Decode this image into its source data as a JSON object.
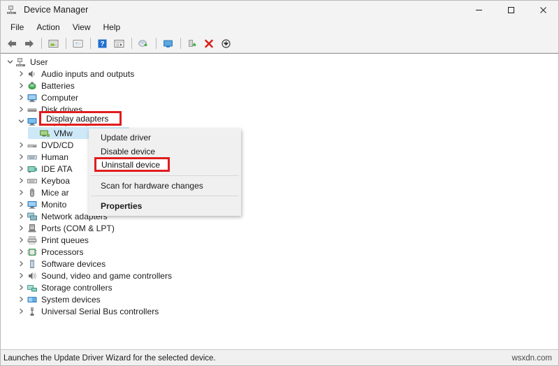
{
  "window": {
    "title": "Device Manager",
    "icon": "device-manager-icon",
    "controls": {
      "minimize": "minimize-icon",
      "maximize": "maximize-icon",
      "close": "close-icon"
    }
  },
  "menubar": {
    "items": [
      {
        "label": "File"
      },
      {
        "label": "Action"
      },
      {
        "label": "View"
      },
      {
        "label": "Help"
      }
    ]
  },
  "toolbar": {
    "buttons": [
      {
        "name": "back-icon",
        "tip": "Back"
      },
      {
        "name": "forward-icon",
        "tip": "Forward"
      },
      {
        "name": "properties-icon",
        "tip": "Properties"
      },
      {
        "name": "view-icon",
        "tip": "View"
      },
      {
        "name": "help-icon",
        "tip": "Help"
      },
      {
        "name": "show-hidden-devices-icon",
        "tip": "Show hidden devices"
      },
      {
        "name": "update-driver-icon",
        "tip": "Update driver"
      },
      {
        "name": "scan-hardware-icon",
        "tip": "Scan for hardware changes"
      },
      {
        "name": "disable-device-icon",
        "tip": "Disable device"
      },
      {
        "name": "uninstall-device-icon",
        "tip": "Uninstall device"
      },
      {
        "name": "download-icon",
        "tip": "Download"
      }
    ]
  },
  "tree": {
    "root": {
      "label": "User",
      "icon": "computer-root-icon",
      "expanded": true
    },
    "items": [
      {
        "label": "Audio inputs and outputs",
        "icon": "audio-icon",
        "level": 1,
        "expanded": false
      },
      {
        "label": "Batteries",
        "icon": "battery-icon",
        "level": 1,
        "expanded": false
      },
      {
        "label": "Computer",
        "icon": "computer-icon",
        "level": 1,
        "expanded": false
      },
      {
        "label": "Disk drives",
        "icon": "disk-drive-icon",
        "level": 1,
        "expanded": false
      },
      {
        "label": "Display adapters",
        "icon": "display-adapter-icon",
        "level": 1,
        "expanded": true
      },
      {
        "label": "VMw",
        "icon": "display-device-icon",
        "level": 2,
        "expanded": false,
        "selected": true
      },
      {
        "label": "DVD/CD",
        "icon": "dvd-icon",
        "level": 1,
        "expanded": false
      },
      {
        "label": "Human",
        "icon": "hid-icon",
        "level": 1,
        "expanded": false
      },
      {
        "label": "IDE ATA",
        "icon": "ide-icon",
        "level": 1,
        "expanded": false
      },
      {
        "label": "Keyboa",
        "icon": "keyboard-icon",
        "level": 1,
        "expanded": false
      },
      {
        "label": "Mice ar",
        "icon": "mouse-icon",
        "level": 1,
        "expanded": false
      },
      {
        "label": "Monito",
        "icon": "monitor-icon",
        "level": 1,
        "expanded": false
      },
      {
        "label": "Network adapters",
        "icon": "network-icon",
        "level": 1,
        "expanded": false
      },
      {
        "label": "Ports (COM & LPT)",
        "icon": "port-icon",
        "level": 1,
        "expanded": false
      },
      {
        "label": "Print queues",
        "icon": "printer-icon",
        "level": 1,
        "expanded": false
      },
      {
        "label": "Processors",
        "icon": "processor-icon",
        "level": 1,
        "expanded": false
      },
      {
        "label": "Software devices",
        "icon": "software-device-icon",
        "level": 1,
        "expanded": false
      },
      {
        "label": "Sound, video and game controllers",
        "icon": "sound-icon",
        "level": 1,
        "expanded": false
      },
      {
        "label": "Storage controllers",
        "icon": "storage-icon",
        "level": 1,
        "expanded": false
      },
      {
        "label": "System devices",
        "icon": "system-device-icon",
        "level": 1,
        "expanded": false
      },
      {
        "label": "Universal Serial Bus controllers",
        "icon": "usb-icon",
        "level": 1,
        "expanded": false
      }
    ]
  },
  "context_menu": {
    "items": [
      {
        "label": "Update driver",
        "bold": false,
        "separator_after": false
      },
      {
        "label": "Disable device",
        "bold": false,
        "separator_after": false
      },
      {
        "label": "Uninstall device",
        "bold": false,
        "separator_after": true
      },
      {
        "label": "Scan for hardware changes",
        "bold": false,
        "separator_after": true
      },
      {
        "label": "Properties",
        "bold": true,
        "separator_after": false
      }
    ]
  },
  "annotations": {
    "color": "#e01d1d",
    "boxes": [
      {
        "id": "display-adapters",
        "label": "Display adapters"
      },
      {
        "id": "uninstall-device",
        "label": "Uninstall device"
      }
    ]
  },
  "statusbar": {
    "text": "Launches the Update Driver Wizard for the selected device.",
    "watermark": "wsxdn.com"
  }
}
